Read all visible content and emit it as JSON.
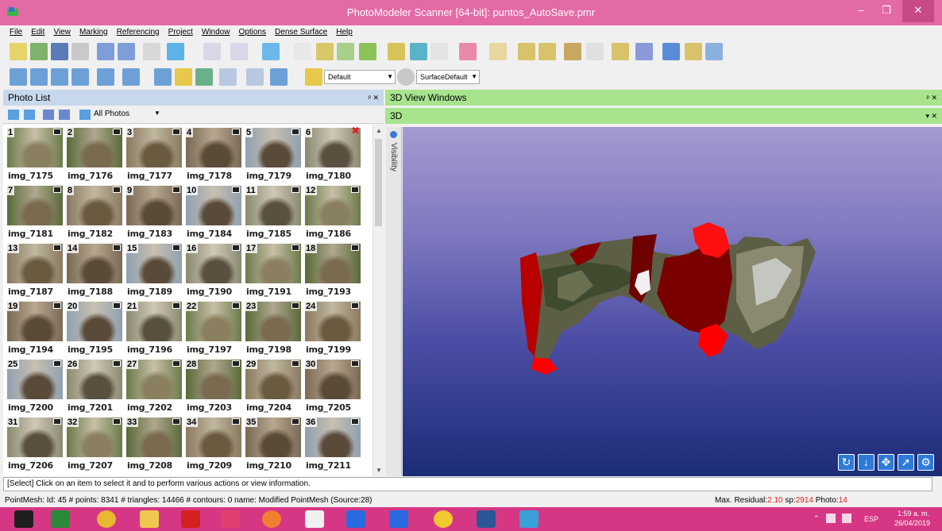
{
  "window": {
    "title": "PhotoModeler Scanner [64-bit]: puntos_AutoSave.pmr",
    "minimize": "–",
    "maximize": "❐",
    "close": "✕"
  },
  "menu": [
    "File",
    "Edit",
    "View",
    "Marking",
    "Referencing",
    "Project",
    "Window",
    "Options",
    "Dense Surface",
    "Help"
  ],
  "toolbar": {
    "style_combo": "Default",
    "surface_combo": "SurfaceDefault"
  },
  "photo_panel": {
    "title": "Photo List",
    "controls": "ᵖ ✕",
    "filter": "All Photos",
    "photos": [
      {
        "n": "1",
        "name": "img_7175"
      },
      {
        "n": "2",
        "name": "img_7176"
      },
      {
        "n": "3",
        "name": "img_7177"
      },
      {
        "n": "4",
        "name": "img_7178"
      },
      {
        "n": "5",
        "name": "img_7179"
      },
      {
        "n": "6",
        "name": "img_7180"
      },
      {
        "n": "7",
        "name": "img_7181"
      },
      {
        "n": "8",
        "name": "img_7182"
      },
      {
        "n": "9",
        "name": "img_7183"
      },
      {
        "n": "10",
        "name": "img_7184"
      },
      {
        "n": "11",
        "name": "img_7185"
      },
      {
        "n": "12",
        "name": "img_7186"
      },
      {
        "n": "13",
        "name": "img_7187"
      },
      {
        "n": "14",
        "name": "img_7188"
      },
      {
        "n": "15",
        "name": "img_7189"
      },
      {
        "n": "16",
        "name": "img_7190"
      },
      {
        "n": "17",
        "name": "img_7191"
      },
      {
        "n": "18",
        "name": "img_7193"
      },
      {
        "n": "19",
        "name": "img_7194"
      },
      {
        "n": "20",
        "name": "img_7195"
      },
      {
        "n": "21",
        "name": "img_7196"
      },
      {
        "n": "22",
        "name": "img_7197"
      },
      {
        "n": "23",
        "name": "img_7198"
      },
      {
        "n": "24",
        "name": "img_7199"
      },
      {
        "n": "25",
        "name": "img_7200"
      },
      {
        "n": "26",
        "name": "img_7201"
      },
      {
        "n": "27",
        "name": "img_7202"
      },
      {
        "n": "28",
        "name": "img_7203"
      },
      {
        "n": "29",
        "name": "img_7204"
      },
      {
        "n": "30",
        "name": "img_7205"
      },
      {
        "n": "31",
        "name": "img_7206"
      },
      {
        "n": "32",
        "name": "img_7207"
      },
      {
        "n": "33",
        "name": "img_7208"
      },
      {
        "n": "34",
        "name": "img_7209"
      },
      {
        "n": "35",
        "name": "img_7210"
      },
      {
        "n": "36",
        "name": "img_7211"
      }
    ]
  },
  "view_panel": {
    "title": "3D View Windows",
    "controls": "ᵖ ✕",
    "tab": "3D",
    "tab_controls": "▾ ✕",
    "visibility": "Visibility"
  },
  "status_line": "[Select] Click on an item to select it and to perform various actions or view information.",
  "status_bar": {
    "left": "PointMesh: Id: 45 # points: 8341 # triangles: 14466 # contours: 0 name: Modified PointMesh (Source:28)",
    "residual_label": "Max. Residual:",
    "residual_value": "2.10",
    "sp_label": " sp:",
    "sp_value": "2914",
    "photo_label": " Photo:",
    "photo_value": "14"
  },
  "taskbar": {
    "language": "ESP",
    "time": "1:59 a. m.",
    "date": "26/04/2019"
  }
}
